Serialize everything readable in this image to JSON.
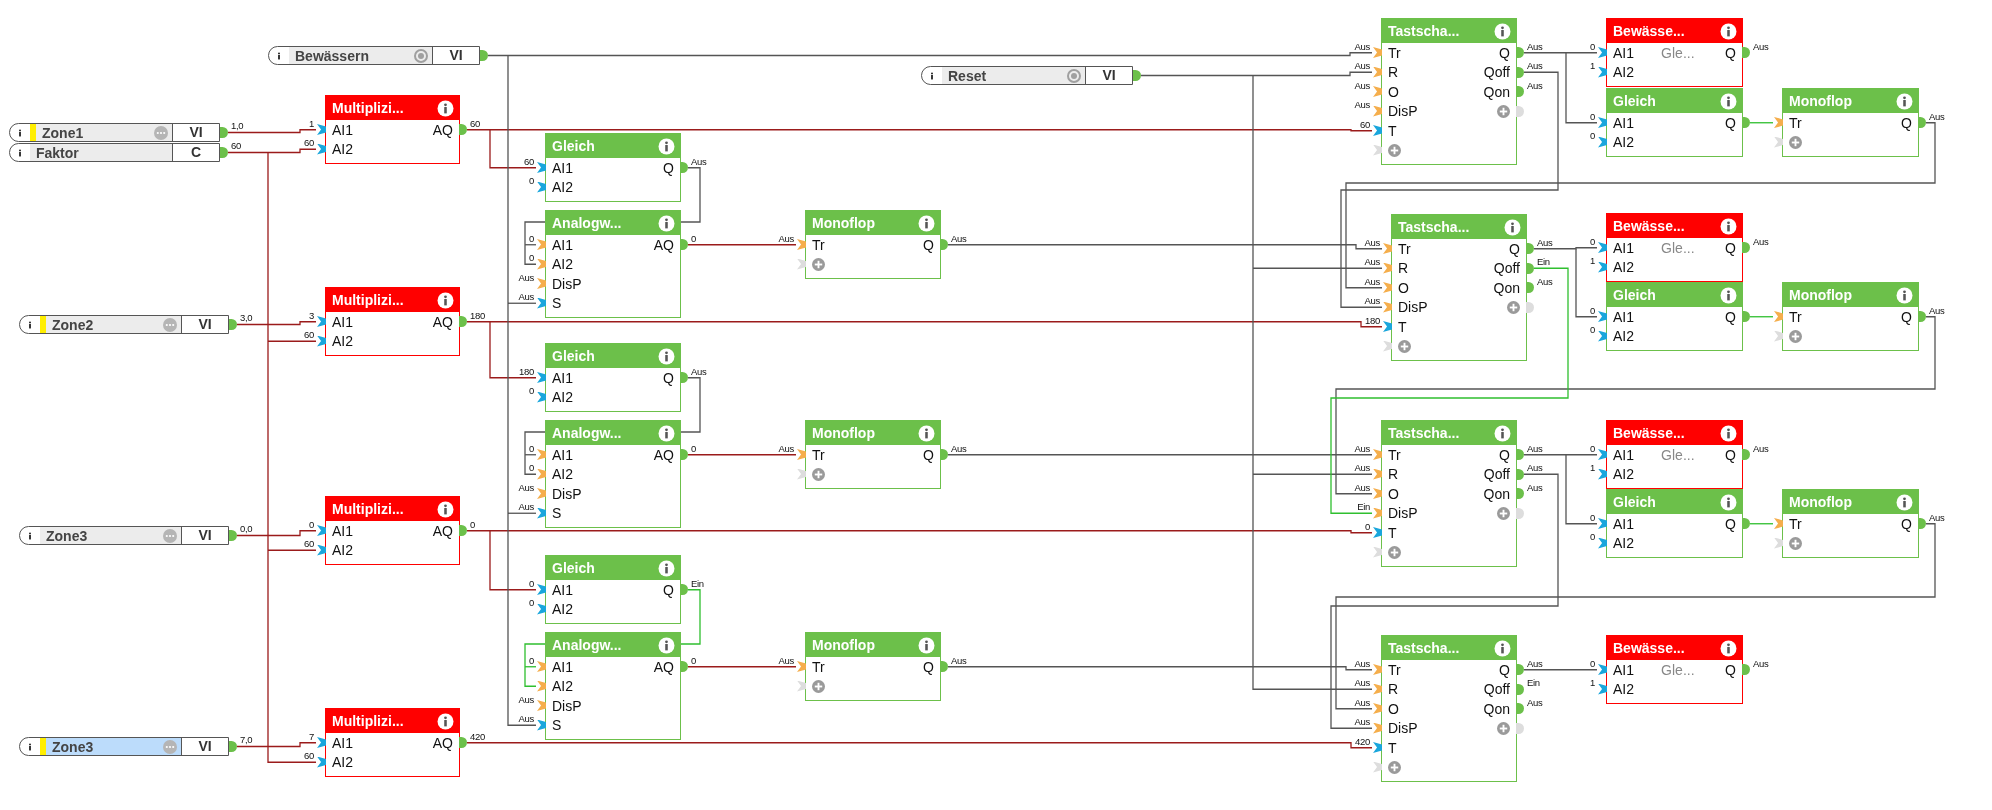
{
  "inputs": [
    {
      "name": "Bewässern",
      "type": "VI",
      "kind": "pulse",
      "marked": false,
      "selected": false
    },
    {
      "name": "Zone1",
      "type": "VI",
      "kind": "analog",
      "marked": true,
      "selected": false,
      "value": "1,0"
    },
    {
      "name": "Faktor",
      "type": "C",
      "kind": "constant",
      "marked": false,
      "selected": false,
      "value": "60"
    },
    {
      "name": "Zone2",
      "type": "VI",
      "kind": "analog",
      "marked": true,
      "selected": false,
      "value": "3,0"
    },
    {
      "name": "Zone3",
      "type": "VI",
      "kind": "analog",
      "marked": false,
      "selected": false,
      "value": "0,0"
    },
    {
      "name": "Zone3",
      "type": "VI",
      "kind": "analog",
      "marked": true,
      "selected": true,
      "value": "7,0"
    },
    {
      "name": "Reset",
      "type": "VI",
      "kind": "pulse",
      "marked": false,
      "selected": false
    }
  ],
  "blocks": [
    {
      "title": "Multiplizi...",
      "error": true,
      "add_input": false,
      "add_output": false,
      "inputs": [
        {
          "name": "AI1",
          "kind": "analog",
          "value": "1"
        },
        {
          "name": "AI2",
          "kind": "analog",
          "value": "60"
        }
      ],
      "outputs": [
        {
          "name": "AQ",
          "value": "60"
        }
      ]
    },
    {
      "title": "Multiplizi...",
      "error": true,
      "add_input": false,
      "add_output": false,
      "inputs": [
        {
          "name": "AI1",
          "kind": "analog",
          "value": "3"
        },
        {
          "name": "AI2",
          "kind": "analog",
          "value": "60"
        }
      ],
      "outputs": [
        {
          "name": "AQ",
          "value": "180"
        }
      ]
    },
    {
      "title": "Multiplizi...",
      "error": true,
      "add_input": false,
      "add_output": false,
      "inputs": [
        {
          "name": "AI1",
          "kind": "analog",
          "value": "0"
        },
        {
          "name": "AI2",
          "kind": "analog",
          "value": "60"
        }
      ],
      "outputs": [
        {
          "name": "AQ",
          "value": "0"
        }
      ]
    },
    {
      "title": "Multiplizi...",
      "error": true,
      "add_input": false,
      "add_output": false,
      "inputs": [
        {
          "name": "AI1",
          "kind": "analog",
          "value": "7"
        },
        {
          "name": "AI2",
          "kind": "analog",
          "value": "60"
        }
      ],
      "outputs": [
        {
          "name": "AQ",
          "value": "420"
        }
      ]
    },
    {
      "title": "Gleich",
      "error": false,
      "add_input": false,
      "add_output": false,
      "inputs": [
        {
          "name": "AI1",
          "kind": "analog",
          "value": "60"
        },
        {
          "name": "AI2",
          "kind": "analog",
          "value": "0"
        }
      ],
      "outputs": [
        {
          "name": "Q",
          "value": "Aus"
        }
      ]
    },
    {
      "title": "Analogw...",
      "error": false,
      "add_input": false,
      "add_output": false,
      "inputs": [
        {
          "name": "AI1",
          "kind": "digital",
          "value": "0"
        },
        {
          "name": "AI2",
          "kind": "digital",
          "value": "0"
        },
        {
          "name": "DisP",
          "kind": "digital",
          "value": "Aus"
        },
        {
          "name": "S",
          "kind": "analog",
          "value": "Aus"
        }
      ],
      "outputs": [
        {
          "name": "AQ",
          "value": "0"
        }
      ]
    },
    {
      "title": "Gleich",
      "error": false,
      "add_input": false,
      "add_output": false,
      "inputs": [
        {
          "name": "AI1",
          "kind": "analog",
          "value": "180"
        },
        {
          "name": "AI2",
          "kind": "analog",
          "value": "0"
        }
      ],
      "outputs": [
        {
          "name": "Q",
          "value": "Aus"
        }
      ]
    },
    {
      "title": "Analogw...",
      "error": false,
      "add_input": false,
      "add_output": false,
      "inputs": [
        {
          "name": "AI1",
          "kind": "digital",
          "value": "0"
        },
        {
          "name": "AI2",
          "kind": "digital",
          "value": "0"
        },
        {
          "name": "DisP",
          "kind": "digital",
          "value": "Aus"
        },
        {
          "name": "S",
          "kind": "analog",
          "value": "Aus"
        }
      ],
      "outputs": [
        {
          "name": "AQ",
          "value": "0"
        }
      ]
    },
    {
      "title": "Gleich",
      "error": false,
      "add_input": false,
      "add_output": false,
      "inputs": [
        {
          "name": "AI1",
          "kind": "analog",
          "value": "0"
        },
        {
          "name": "AI2",
          "kind": "analog",
          "value": "0"
        }
      ],
      "outputs": [
        {
          "name": "Q",
          "value": "Ein"
        }
      ]
    },
    {
      "title": "Analogw...",
      "error": false,
      "add_input": false,
      "add_output": false,
      "inputs": [
        {
          "name": "AI1",
          "kind": "digital",
          "value": "0"
        },
        {
          "name": "AI2",
          "kind": "digital"
        },
        {
          "name": "DisP",
          "kind": "digital",
          "value": "Aus"
        },
        {
          "name": "S",
          "kind": "analog",
          "value": "Aus"
        }
      ],
      "outputs": [
        {
          "name": "AQ",
          "value": "0"
        }
      ]
    },
    {
      "title": "Monoflop",
      "error": false,
      "add_input": true,
      "add_output": false,
      "inputs": [
        {
          "name": "Tr",
          "kind": "digital",
          "value": "Aus"
        }
      ],
      "outputs": [
        {
          "name": "Q",
          "value": "Aus"
        }
      ]
    },
    {
      "title": "Monoflop",
      "error": false,
      "add_input": true,
      "add_output": false,
      "inputs": [
        {
          "name": "Tr",
          "kind": "digital",
          "value": "Aus"
        }
      ],
      "outputs": [
        {
          "name": "Q",
          "value": "Aus"
        }
      ]
    },
    {
      "title": "Monoflop",
      "error": false,
      "add_input": true,
      "add_output": false,
      "inputs": [
        {
          "name": "Tr",
          "kind": "digital",
          "value": "Aus"
        }
      ],
      "outputs": [
        {
          "name": "Q",
          "value": "Aus"
        }
      ]
    },
    {
      "title": "Tastscha...",
      "error": false,
      "add_input": true,
      "add_output": true,
      "inputs": [
        {
          "name": "Tr",
          "kind": "digital",
          "value": "Aus"
        },
        {
          "name": "R",
          "kind": "digital",
          "value": "Aus"
        },
        {
          "name": "O",
          "kind": "digital",
          "value": "Aus"
        },
        {
          "name": "DisP",
          "kind": "digital",
          "value": "Aus"
        },
        {
          "name": "T",
          "kind": "analog",
          "value": "60"
        }
      ],
      "outputs": [
        {
          "name": "Q",
          "value": "Aus"
        },
        {
          "name": "Qoff",
          "value": "Aus"
        },
        {
          "name": "Qon",
          "value": "Aus"
        }
      ]
    },
    {
      "title": "Tastscha...",
      "error": false,
      "add_input": true,
      "add_output": true,
      "inputs": [
        {
          "name": "Tr",
          "kind": "digital",
          "value": "Aus"
        },
        {
          "name": "R",
          "kind": "digital",
          "value": "Aus"
        },
        {
          "name": "O",
          "kind": "digital",
          "value": "Aus"
        },
        {
          "name": "DisP",
          "kind": "digital",
          "value": "Aus"
        },
        {
          "name": "T",
          "kind": "analog",
          "value": "180"
        }
      ],
      "outputs": [
        {
          "name": "Q",
          "value": "Aus"
        },
        {
          "name": "Qoff",
          "value": "Ein"
        },
        {
          "name": "Qon",
          "value": "Aus"
        }
      ]
    },
    {
      "title": "Tastscha...",
      "error": false,
      "add_input": true,
      "add_output": true,
      "inputs": [
        {
          "name": "Tr",
          "kind": "digital",
          "value": "Aus"
        },
        {
          "name": "R",
          "kind": "digital",
          "value": "Aus"
        },
        {
          "name": "O",
          "kind": "digital",
          "value": "Aus"
        },
        {
          "name": "DisP",
          "kind": "digital",
          "value": "Ein"
        },
        {
          "name": "T",
          "kind": "analog",
          "value": "0"
        }
      ],
      "outputs": [
        {
          "name": "Q",
          "value": "Aus"
        },
        {
          "name": "Qoff",
          "value": "Aus"
        },
        {
          "name": "Qon",
          "value": "Aus"
        }
      ]
    },
    {
      "title": "Tastscha...",
      "error": false,
      "add_input": true,
      "add_output": true,
      "inputs": [
        {
          "name": "Tr",
          "kind": "digital",
          "value": "Aus"
        },
        {
          "name": "R",
          "kind": "digital",
          "value": "Aus"
        },
        {
          "name": "O",
          "kind": "digital",
          "value": "Aus"
        },
        {
          "name": "DisP",
          "kind": "digital",
          "value": "Aus"
        },
        {
          "name": "T",
          "kind": "analog",
          "value": "420"
        }
      ],
      "outputs": [
        {
          "name": "Q",
          "value": "Aus"
        },
        {
          "name": "Qoff",
          "value": "Ein"
        },
        {
          "name": "Qon",
          "value": "Aus"
        }
      ]
    },
    {
      "title": "Bewässe...",
      "error": true,
      "param": "Gle...",
      "add_input": false,
      "add_output": false,
      "inputs": [
        {
          "name": "AI1",
          "kind": "analog",
          "value": "0"
        },
        {
          "name": "AI2",
          "kind": "analog",
          "value": "1"
        }
      ],
      "outputs": [
        {
          "name": "Q",
          "value": "Aus"
        }
      ]
    },
    {
      "title": "Gleich",
      "error": false,
      "add_input": false,
      "add_output": false,
      "inputs": [
        {
          "name": "AI1",
          "kind": "analog",
          "value": "0"
        },
        {
          "name": "AI2",
          "kind": "analog",
          "value": "0"
        }
      ],
      "outputs": [
        {
          "name": "Q"
        }
      ]
    },
    {
      "title": "Bewässe...",
      "error": true,
      "param": "Gle...",
      "add_input": false,
      "add_output": false,
      "inputs": [
        {
          "name": "AI1",
          "kind": "analog",
          "value": "0"
        },
        {
          "name": "AI2",
          "kind": "analog",
          "value": "1"
        }
      ],
      "outputs": [
        {
          "name": "Q",
          "value": "Aus"
        }
      ]
    },
    {
      "title": "Gleich",
      "error": false,
      "add_input": false,
      "add_output": false,
      "inputs": [
        {
          "name": "AI1",
          "kind": "analog",
          "value": "0"
        },
        {
          "name": "AI2",
          "kind": "analog",
          "value": "0"
        }
      ],
      "outputs": [
        {
          "name": "Q"
        }
      ]
    },
    {
      "title": "Bewässe...",
      "error": true,
      "param": "Gle...",
      "add_input": false,
      "add_output": false,
      "inputs": [
        {
          "name": "AI1",
          "kind": "analog",
          "value": "0"
        },
        {
          "name": "AI2",
          "kind": "analog",
          "value": "1"
        }
      ],
      "outputs": [
        {
          "name": "Q",
          "value": "Aus"
        }
      ]
    },
    {
      "title": "Gleich",
      "error": false,
      "add_input": false,
      "add_output": false,
      "inputs": [
        {
          "name": "AI1",
          "kind": "analog",
          "value": "0"
        },
        {
          "name": "AI2",
          "kind": "analog",
          "value": "0"
        }
      ],
      "outputs": [
        {
          "name": "Q"
        }
      ]
    },
    {
      "title": "Bewässe...",
      "error": true,
      "param": "Gle...",
      "add_input": false,
      "add_output": false,
      "inputs": [
        {
          "name": "AI1",
          "kind": "analog",
          "value": "0"
        },
        {
          "name": "AI2",
          "kind": "analog",
          "value": "1"
        }
      ],
      "outputs": [
        {
          "name": "Q",
          "value": "Aus"
        }
      ]
    },
    {
      "title": "Monoflop",
      "error": false,
      "add_input": true,
      "add_output": false,
      "inputs": [
        {
          "name": "Tr",
          "kind": "digital"
        }
      ],
      "outputs": [
        {
          "name": "Q",
          "value": "Aus"
        }
      ]
    },
    {
      "title": "Monoflop",
      "error": false,
      "add_input": true,
      "add_output": false,
      "inputs": [
        {
          "name": "Tr",
          "kind": "digital"
        }
      ],
      "outputs": [
        {
          "name": "Q",
          "value": "Aus"
        }
      ]
    },
    {
      "title": "Monoflop",
      "error": false,
      "add_input": true,
      "add_output": false,
      "inputs": [
        {
          "name": "Tr",
          "kind": "digital"
        }
      ],
      "outputs": [
        {
          "name": "Q",
          "value": "Aus"
        }
      ]
    }
  ]
}
